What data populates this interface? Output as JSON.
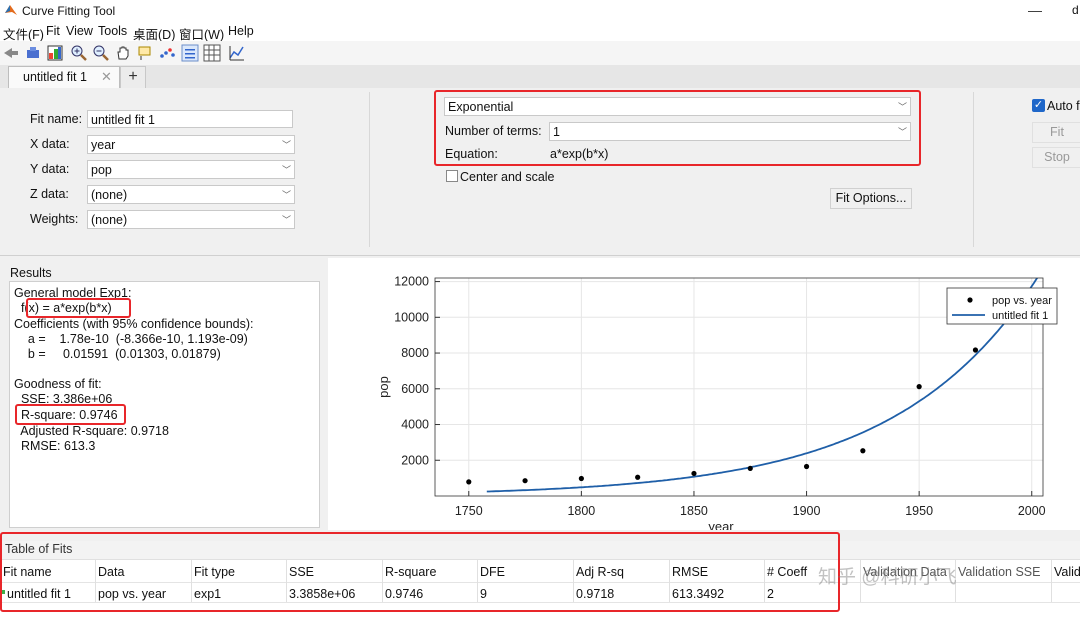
{
  "window": {
    "title": "Curve Fitting Tool",
    "edge_char": "d"
  },
  "menu": [
    "文件(F)",
    "Fit",
    "View",
    "Tools",
    "桌面(D)",
    "窗口(W)",
    "Help"
  ],
  "tabs": {
    "active": "untitled fit 1",
    "add": "+"
  },
  "fit_setup": {
    "fit_name_label": "Fit name:",
    "fit_name": "untitled fit 1",
    "x_label": "X data:",
    "x_value": "year",
    "y_label": "Y data:",
    "y_value": "pop",
    "z_label": "Z data:",
    "z_value": "(none)",
    "w_label": "Weights:",
    "w_value": "(none)"
  },
  "fit_type": {
    "type": "Exponential",
    "terms_label": "Number of terms:",
    "terms": "1",
    "equation_label": "Equation:",
    "equation": "a*exp(b*x)",
    "center_scale": "Center and scale",
    "options_button": "Fit Options..."
  },
  "controls": {
    "auto_fit": "Auto f",
    "fit": "Fit",
    "stop": "Stop"
  },
  "results": {
    "title": "Results",
    "lines": [
      "General model Exp1:",
      "  f(x) = a*exp(b*x)",
      "Coefficients (with 95% confidence bounds):",
      "    a =    1.78e-10  (-8.366e-10, 1.193e-09)",
      "    b =     0.01591  (0.01303, 0.01879)",
      "",
      "Goodness of fit:",
      "  SSE: 3.386e+06",
      "  R-square: 0.9746",
      "  Adjusted R-square: 0.9718",
      "  RMSE: 613.3"
    ]
  },
  "chart_data": {
    "type": "scatter",
    "xlabel": "year",
    "ylabel": "pop",
    "xlim": [
      1735,
      2005
    ],
    "ylim": [
      0,
      12200
    ],
    "xticks": [
      1750,
      1800,
      1850,
      1900,
      1950,
      2000
    ],
    "yticks": [
      2000,
      4000,
      6000,
      8000,
      10000,
      12000
    ],
    "grid": true,
    "legend_position": "top-right",
    "series": [
      {
        "name": "pop vs. year",
        "kind": "points",
        "color": "#000000",
        "x": [
          1750,
          1775,
          1800,
          1825,
          1850,
          1875,
          1900,
          1925,
          1950,
          1975
        ],
        "y": [
          791,
          856,
          978,
          1050,
          1262,
          1544,
          1650,
          2532,
          6122,
          8170
        ]
      },
      {
        "name": "untitled fit 1",
        "kind": "curve",
        "color": "#1f5fa8",
        "model": "a*exp(b*x)",
        "a": 1.78e-10,
        "b": 0.01591
      }
    ]
  },
  "table": {
    "title": "Table of Fits",
    "columns": [
      "Fit name",
      "Data",
      "Fit type",
      "SSE",
      "R-square",
      "DFE",
      "Adj R-sq",
      "RMSE",
      "# Coeff",
      "Validation Data",
      "Validation SSE",
      "Valid"
    ],
    "rows": [
      [
        "untitled fit 1",
        "pop vs. year",
        "exp1",
        "3.3858e+06",
        "0.9746",
        "9",
        "0.9718",
        "613.3492",
        "2",
        "",
        "",
        ""
      ]
    ]
  },
  "watermark": "知乎 @科研小飞",
  "colors": {
    "highlight": "#e8262a",
    "fit_line": "#1f5fa8",
    "points": "#000000"
  }
}
